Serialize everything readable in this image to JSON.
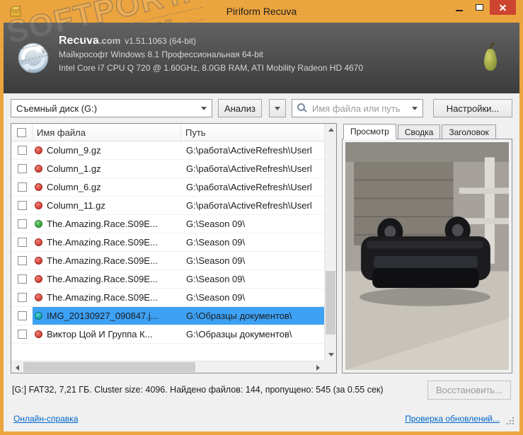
{
  "window": {
    "title": "Piriform Recuva"
  },
  "header": {
    "brand": "Recuva",
    "brand_suffix": ".com",
    "version": "v1.51.1063 (64-bit)",
    "os_line": "Майкрософт Windows 8.1 Профессиональная 64-bit",
    "hardware_line": "Intel Core i7 CPU Q 720 @ 1.60GHz, 8.0GB RAM, ATI Mobility Radeon HD 4670",
    "watermark": {
      "main": "SOFTPORTAL",
      "tm": "TM",
      "sub": "www.softportal.com"
    }
  },
  "toolbar": {
    "drive_select_value": "Съемный диск (G:)",
    "analyze_button": "Анализ",
    "search_placeholder": "Имя файла или путь",
    "settings_button": "Настройки..."
  },
  "filelist": {
    "columns": [
      "Имя файла",
      "Путь"
    ],
    "rows": [
      {
        "status": "red",
        "name": "Column_9.gz",
        "path": "G:\\работа\\ActiveRefresh\\Userl",
        "selected": false
      },
      {
        "status": "red",
        "name": "Column_1.gz",
        "path": "G:\\работа\\ActiveRefresh\\Userl",
        "selected": false
      },
      {
        "status": "red",
        "name": "Column_6.gz",
        "path": "G:\\работа\\ActiveRefresh\\Userl",
        "selected": false
      },
      {
        "status": "red",
        "name": "Column_11.gz",
        "path": "G:\\работа\\ActiveRefresh\\Userl",
        "selected": false
      },
      {
        "status": "green",
        "name": "The.Amazing.Race.S09E...",
        "path": "G:\\Season 09\\",
        "selected": false
      },
      {
        "status": "red",
        "name": "The.Amazing.Race.S09E...",
        "path": "G:\\Season 09\\",
        "selected": false
      },
      {
        "status": "red",
        "name": "The.Amazing.Race.S09E...",
        "path": "G:\\Season 09\\",
        "selected": false
      },
      {
        "status": "red",
        "name": "The.Amazing.Race.S09E...",
        "path": "G:\\Season 09\\",
        "selected": false
      },
      {
        "status": "red",
        "name": "The.Amazing.Race.S09E...",
        "path": "G:\\Season 09\\",
        "selected": false
      },
      {
        "status": "teal",
        "name": "IMG_20130927_090847.j...",
        "path": "G:\\Образцы документов\\",
        "selected": true
      },
      {
        "status": "red",
        "name": "Виктор Цой И Группа К...",
        "path": "G:\\Образцы документов\\",
        "selected": false
      }
    ]
  },
  "preview": {
    "tabs": [
      {
        "label": "Просмотр",
        "slug": "preview"
      },
      {
        "label": "Сводка",
        "slug": "summary"
      },
      {
        "label": "Заголовок",
        "slug": "header"
      }
    ],
    "active_slug": "preview"
  },
  "statusbar": {
    "text": "[G:] FAT32, 7,21 ГБ. Cluster size: 4096. Найдено файлов: 144, пропущено: 545 (за 0.55 сек)",
    "recover_button": "Восстановить..."
  },
  "footer": {
    "help_link": "Онлайн-справка",
    "updates_link": "Проверка обновлений..."
  },
  "colors": {
    "accent": "#eca43e",
    "selection": "#3da1f5",
    "status_red": "#d23c32",
    "status_green": "#2f9e38",
    "status_teal": "#0e9aa3",
    "header_dark": "#4a4a4a"
  }
}
